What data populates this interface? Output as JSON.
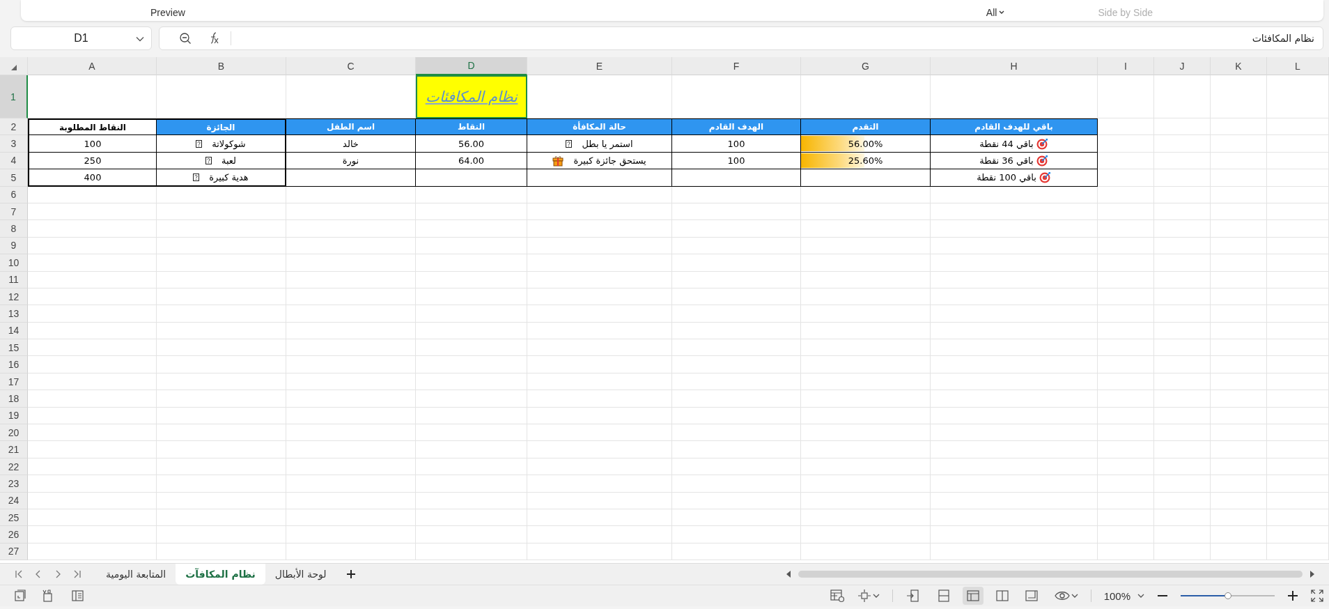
{
  "ribbon": {
    "items": [
      {
        "label": "Side by Side",
        "kind": "text",
        "disabled": true
      },
      {
        "label": "All",
        "kind": "dropdown",
        "disabled": false
      },
      {
        "label": "Preview",
        "kind": "text",
        "disabled": false
      }
    ]
  },
  "name_box": {
    "value": "D1"
  },
  "formula_bar": {
    "value": "نظام المكافئات"
  },
  "columns": [
    {
      "label": "L",
      "selected": false
    },
    {
      "label": "K",
      "selected": false
    },
    {
      "label": "J",
      "selected": false
    },
    {
      "label": "I",
      "selected": false
    },
    {
      "label": "H",
      "selected": false
    },
    {
      "label": "G",
      "selected": false
    },
    {
      "label": "F",
      "selected": false
    },
    {
      "label": "E",
      "selected": false
    },
    {
      "label": "D",
      "selected": true
    },
    {
      "label": "C",
      "selected": false
    },
    {
      "label": "B",
      "selected": false
    },
    {
      "label": "A",
      "selected": false
    }
  ],
  "rows": [
    {
      "label": "1",
      "selected": true
    },
    {
      "label": "2",
      "selected": false
    },
    {
      "label": "3",
      "selected": false
    },
    {
      "label": "4",
      "selected": false
    },
    {
      "label": "5",
      "selected": false
    },
    {
      "label": "6",
      "selected": false
    },
    {
      "label": "7",
      "selected": false
    },
    {
      "label": "8",
      "selected": false
    },
    {
      "label": "9",
      "selected": false
    },
    {
      "label": "10",
      "selected": false
    },
    {
      "label": "11",
      "selected": false
    },
    {
      "label": "12",
      "selected": false
    },
    {
      "label": "13",
      "selected": false
    },
    {
      "label": "14",
      "selected": false
    },
    {
      "label": "15",
      "selected": false
    },
    {
      "label": "16",
      "selected": false
    },
    {
      "label": "17",
      "selected": false
    },
    {
      "label": "18",
      "selected": false
    },
    {
      "label": "19",
      "selected": false
    },
    {
      "label": "20",
      "selected": false
    },
    {
      "label": "21",
      "selected": false
    },
    {
      "label": "22",
      "selected": false
    },
    {
      "label": "23",
      "selected": false
    },
    {
      "label": "24",
      "selected": false
    },
    {
      "label": "25",
      "selected": false
    },
    {
      "label": "26",
      "selected": false
    },
    {
      "label": "27",
      "selected": false
    }
  ],
  "title_cell": {
    "text": "نظام المكافئات",
    "selected": true
  },
  "table": [
    {
      "cells": [
        {
          "kind": "heading",
          "text": "باقي للهدف القادم"
        },
        {
          "kind": "heading",
          "text": "التقدم"
        },
        {
          "kind": "heading",
          "text": "الهدف القادم"
        },
        {
          "kind": "heading",
          "text": "حالة المكافأة"
        },
        {
          "kind": "heading",
          "text": "النقاط"
        },
        {
          "kind": "heading",
          "text": "اسم الطفل"
        },
        {
          "kind": "heading",
          "text": "الجائزة"
        },
        {
          "kind": "heading-plain",
          "text": "النقاط المطلوبة"
        }
      ]
    },
    {
      "cells": [
        {
          "kind": "target",
          "text": "باقي 44 نقطة"
        },
        {
          "kind": "bar",
          "text": "56.00%",
          "level": 0.49
        },
        {
          "kind": "text",
          "text": "100"
        },
        {
          "kind": "glyph",
          "text": "استمر يا بطل"
        },
        {
          "kind": "text",
          "text": "56.00"
        },
        {
          "kind": "text",
          "text": "خالد"
        },
        {
          "kind": "glyph",
          "text": "شوكولاتة"
        },
        {
          "kind": "text",
          "text": "100"
        }
      ]
    },
    {
      "cells": [
        {
          "kind": "target",
          "text": "باقي 36 نقطة"
        },
        {
          "kind": "bar",
          "text": "25.60%",
          "level": 0.49
        },
        {
          "kind": "text",
          "text": "100"
        },
        {
          "kind": "gift",
          "text": "يستحق جائزة كبيرة"
        },
        {
          "kind": "text",
          "text": "64.00"
        },
        {
          "kind": "text",
          "text": "نورة"
        },
        {
          "kind": "glyph",
          "text": "لعبة"
        },
        {
          "kind": "text",
          "text": "250"
        }
      ]
    },
    {
      "cells": [
        {
          "kind": "target",
          "text": "باقي 100 نقطة"
        },
        {
          "kind": "blank"
        },
        {
          "kind": "blank"
        },
        {
          "kind": "blank"
        },
        {
          "kind": "blank"
        },
        {
          "kind": "blank"
        },
        {
          "kind": "glyph",
          "text": "هدية كبيرة"
        },
        {
          "kind": "text",
          "text": "400"
        }
      ]
    }
  ],
  "sheet_tabs": [
    {
      "label": "لوحة الأبطال",
      "selected": false
    },
    {
      "label": "نظام المكافآت",
      "selected": true
    },
    {
      "label": "المتابعة اليومية",
      "selected": false
    }
  ],
  "view_modes": [
    {
      "kind": "page-break",
      "selected": false
    },
    {
      "kind": "normal",
      "selected": true
    },
    {
      "kind": "split",
      "selected": false
    },
    {
      "kind": "layout",
      "selected": false
    }
  ],
  "zoom": {
    "value": "100%",
    "level": 0.5
  }
}
